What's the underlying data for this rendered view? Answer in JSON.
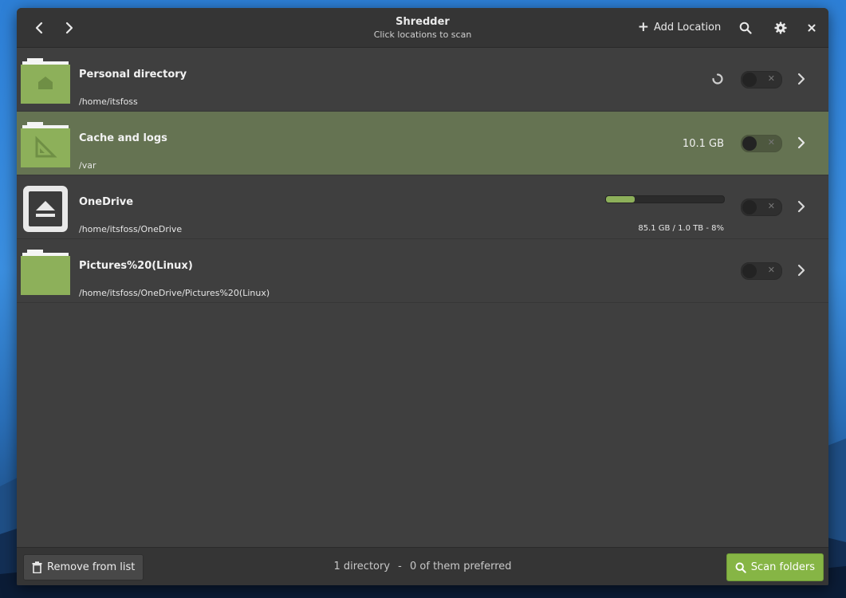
{
  "window": {
    "title": "Shredder",
    "subtitle": "Click locations to scan",
    "add_location_label": "Add Location"
  },
  "locations": [
    {
      "name": "Personal directory",
      "path": "/home/itsfoss",
      "icon": "home-folder-icon",
      "scanning": true,
      "enabled": false
    },
    {
      "name": "Cache and logs",
      "path": "/var",
      "icon": "system-folder-icon",
      "size": "10.1 GB",
      "selected": true,
      "enabled": false
    },
    {
      "name": "OneDrive",
      "path": "/home/itsfoss/OneDrive",
      "icon": "drive-eject-icon",
      "usage": "85.1 GB / 1.0 TB - 8%",
      "usage_fraction": 0.08,
      "enabled": false
    },
    {
      "name": "Pictures%20(Linux)",
      "path": "/home/itsfoss/OneDrive/Pictures%20(Linux)",
      "icon": "folder-icon",
      "enabled": false
    }
  ],
  "bottombar": {
    "remove_label": "Remove from list",
    "status_count": "1 directory",
    "status_sep": "-",
    "status_preferred": "0 of them preferred",
    "scan_label": "Scan folders"
  },
  "colors": {
    "accent": "#86b545",
    "selected_row": "#657352",
    "folder_green": "#8db05a"
  }
}
